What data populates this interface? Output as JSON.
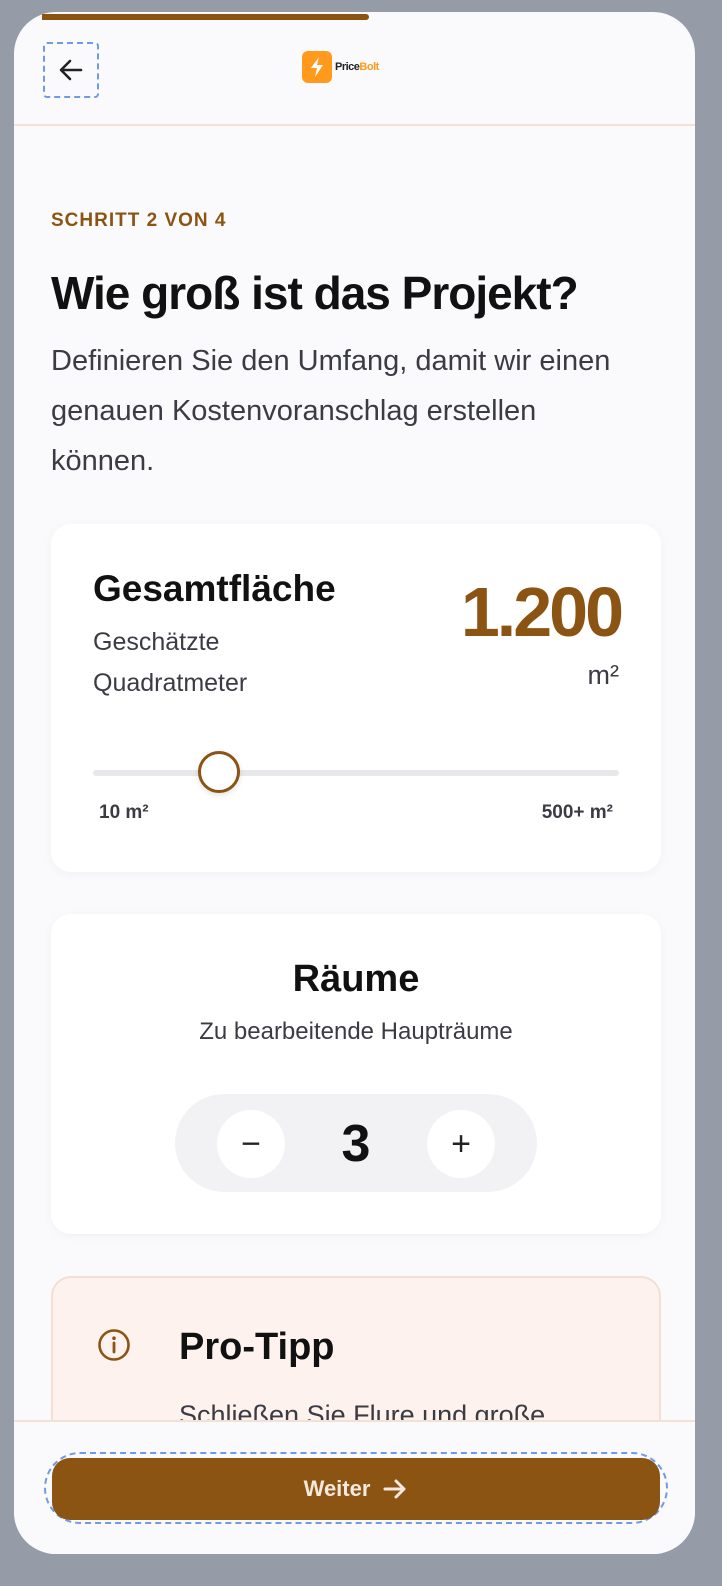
{
  "header": {
    "logo": {
      "word_main": "Price",
      "word_accent": "Bolt"
    },
    "back_icon": "arrow-left-icon"
  },
  "progress": {
    "fraction": 0.5
  },
  "step_label": "SCHRITT 2 VON 4",
  "title": "Wie groß ist das Projekt?",
  "subtitle": "Definieren Sie den Umfang, damit wir einen genauen Kostenvoranschlag erstellen können.",
  "area": {
    "title": "Gesamtfläche",
    "subtitle": "Geschätzte Quadratmeter",
    "value": "1.200",
    "unit": "m²",
    "slider": {
      "min_label": "10 m²",
      "max_label": "500+ m²",
      "level_fraction": 0.24
    }
  },
  "rooms": {
    "title": "Räume",
    "subtitle": "Zu bearbeitende Haupträume",
    "count": "3",
    "minus_symbol": "−",
    "plus_symbol": "+"
  },
  "tip": {
    "title": "Pro-Tipp",
    "text": "Schließen Sie Flure und große"
  },
  "footer": {
    "cta_label": "Weiter"
  },
  "colors": {
    "accent": "#8b5413",
    "brand": "#ff9a1c",
    "focus_outline": "#6f9ae6",
    "tip_background": "#fdf2ee"
  }
}
